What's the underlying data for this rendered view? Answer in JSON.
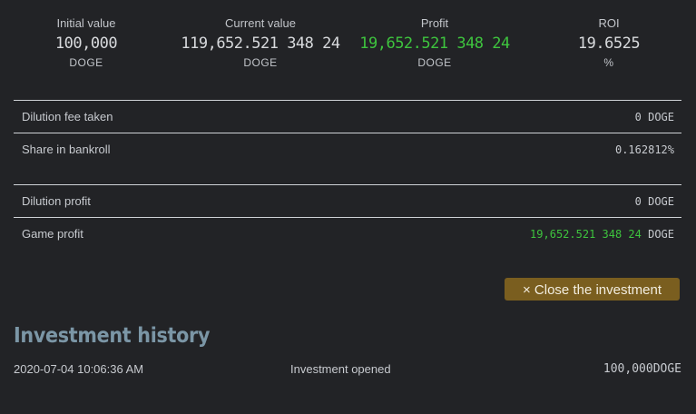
{
  "stats": [
    {
      "label": "Initial value",
      "value": "100,000",
      "unit": "DOGE",
      "highlight": false
    },
    {
      "label": "Current value",
      "value": "119,652.521 348 24",
      "unit": "DOGE",
      "highlight": false
    },
    {
      "label": "Profit",
      "value": "19,652.521 348 24",
      "unit": "DOGE",
      "highlight": true
    },
    {
      "label": "ROI",
      "value": "19.6525",
      "unit": "%",
      "highlight": false
    }
  ],
  "details": {
    "dilution_fee": {
      "label": "Dilution fee taken",
      "value": "0 DOGE"
    },
    "share": {
      "label": "Share in bankroll",
      "value": "0.162812%"
    },
    "dilution_profit": {
      "label": "Dilution profit",
      "value": "0 DOGE"
    },
    "game_profit": {
      "label": "Game profit",
      "value": "19,652.521 348 24",
      "unit": " DOGE"
    }
  },
  "actions": {
    "close_label": "× Close the investment"
  },
  "history": {
    "title": "Investment history",
    "entries": [
      {
        "date": "2020-07-04 10:06:36 AM",
        "event": "Investment opened",
        "amount": "100,000DOGE"
      }
    ]
  },
  "colors": {
    "profit": "#3ec43e",
    "accent_button": "#7a5e1f",
    "history_title": "#7b96a6",
    "background": "#222326"
  }
}
